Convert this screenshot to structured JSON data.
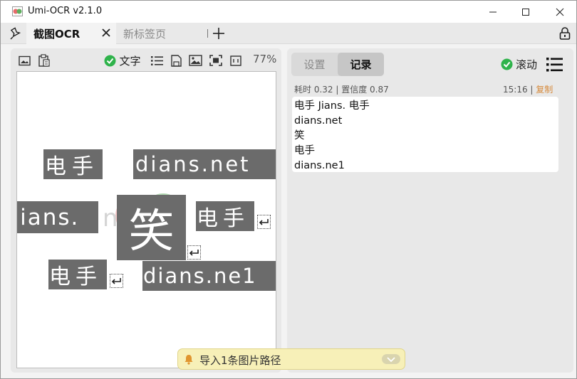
{
  "window": {
    "title": "Umi-OCR v2.1.0"
  },
  "tabs": [
    {
      "label": "截图OCR",
      "active": true
    },
    {
      "label": "新标签页",
      "active": false
    }
  ],
  "left_toolbar": {
    "text_checkbox_label": "文字",
    "text_checked": true,
    "zoom": "77%",
    "icons": [
      "image-icon",
      "clipboard-icon",
      "list-icon",
      "save-icon",
      "picture-icon",
      "screenshot-icon",
      "window-icon"
    ]
  },
  "ocr_overlay": {
    "boxes": [
      "电手",
      "dians.net",
      "Jians.",
      "笑",
      "电手",
      "电手",
      "dians.ne1"
    ],
    "background_char": "n"
  },
  "right_panel": {
    "tabs": [
      "设置",
      "记录"
    ],
    "active_tab": "记录",
    "scroll_label": "滚动",
    "scroll_checked": true,
    "meta_left": "耗时 0.32 | 置信度 0.87",
    "meta_time": "15:16",
    "meta_sep": " | ",
    "copy_label": "复制",
    "results": [
      "电手 Jians. 电手",
      "dians.net",
      "笑",
      "电手",
      "dians.ne1"
    ]
  },
  "toast": {
    "text": "导入1条图片路径"
  },
  "colors": {
    "check_green": "#2fb34b",
    "copy_orange": "#d68a3c",
    "ocr_box_gray": "#6b6b6b",
    "toast_yellow": "#f7f0b8",
    "desktop_blue": "#1d7fb8"
  }
}
